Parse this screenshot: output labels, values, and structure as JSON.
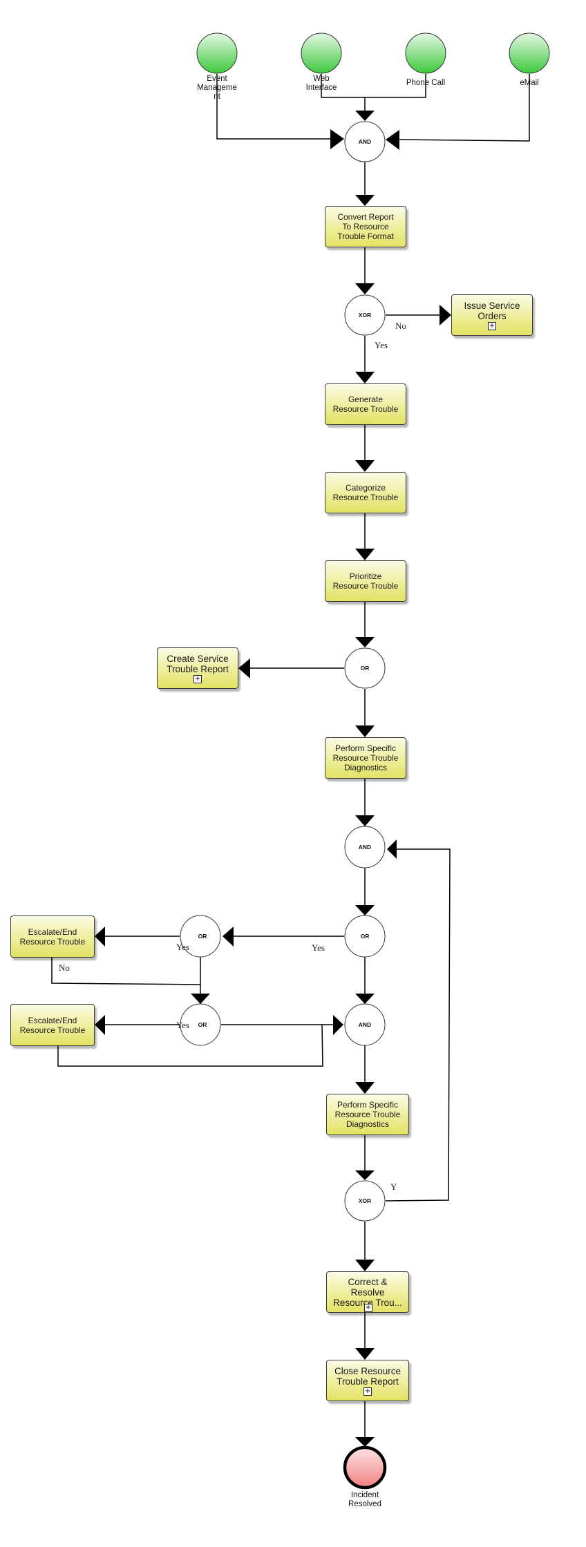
{
  "diagram": {
    "type": "BPMN process flow",
    "start_events": [
      {
        "id": "start-event-management",
        "label": "Event\nManageme\nnt"
      },
      {
        "id": "start-web-interface",
        "label": "Web\nInterface"
      },
      {
        "id": "start-phone-call",
        "label": "Phone Call"
      },
      {
        "id": "start-email",
        "label": "eMail"
      }
    ],
    "gateways": [
      {
        "id": "and-1",
        "label": "AND"
      },
      {
        "id": "xor-1",
        "label": "XOR"
      },
      {
        "id": "or-1",
        "label": "OR"
      },
      {
        "id": "and-2",
        "label": "AND"
      },
      {
        "id": "or-2",
        "label": "OR"
      },
      {
        "id": "or-3",
        "label": "OR"
      },
      {
        "id": "and-3",
        "label": "AND"
      },
      {
        "id": "or-4",
        "label": "OR"
      },
      {
        "id": "xor-2",
        "label": "XOR"
      }
    ],
    "tasks": [
      {
        "id": "convert-report",
        "label": "Convert Report\nTo Resource\nTrouble Format",
        "subprocess": false
      },
      {
        "id": "issue-service-orders",
        "label": "Issue Service\nOrders",
        "subprocess": true
      },
      {
        "id": "generate-resource-trouble",
        "label": "Generate\nResource Trouble",
        "subprocess": false
      },
      {
        "id": "categorize-resource-trouble",
        "label": "Categorize\nResource Trouble",
        "subprocess": false
      },
      {
        "id": "prioritize-resource-trouble",
        "label": "Prioritize\nResource Trouble",
        "subprocess": false
      },
      {
        "id": "create-service-trouble-report",
        "label": "Create Service\nTrouble Report",
        "subprocess": true
      },
      {
        "id": "perform-diagnostics-1",
        "label": "Perform Specific\nResource Trouble\nDiagnostics",
        "subprocess": false
      },
      {
        "id": "escalate-end-1",
        "label": "Escalate/End\nResource Trouble",
        "subprocess": false
      },
      {
        "id": "escalate-end-2",
        "label": "Escalate/End\nResource Trouble",
        "subprocess": false
      },
      {
        "id": "perform-diagnostics-2",
        "label": "Perform Specific\nResource Trouble\nDiagnostics",
        "subprocess": false
      },
      {
        "id": "correct-resolve",
        "label": "Correct &\nResolve\nResource Trou...",
        "subprocess": true
      },
      {
        "id": "close-report",
        "label": "Close Resource\nTrouble Report",
        "subprocess": true
      }
    ],
    "end_event": {
      "id": "incident-resolved",
      "label": "Incident\nResolved"
    },
    "conditions": {
      "xor1_no": "No",
      "xor1_yes": "Yes",
      "or2_yes": "Yes",
      "or3_yes": "Yes",
      "escalate1_no": "No",
      "or4_yes": "Yes",
      "xor2_y": "Y"
    },
    "subprocess_marker": "+",
    "colors": {
      "start_event_top": "#e4f8e4",
      "start_event_bottom": "#3ec93e",
      "task_top": "#fbfbe6",
      "task_bottom": "#e2e264",
      "end_event_top": "#fde4e4",
      "end_event_bottom": "#f28080",
      "line": "#000000"
    }
  }
}
